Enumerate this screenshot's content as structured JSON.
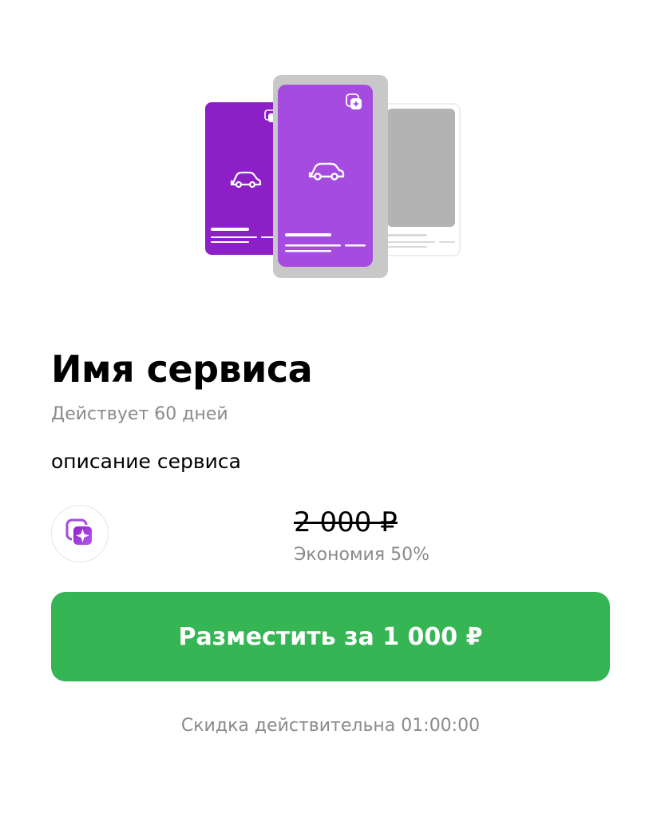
{
  "service": {
    "title": "Имя сервиса",
    "duration": "Действует 60 дней",
    "description": "описание сервиса"
  },
  "pricing": {
    "old_price": "2 000 ₽",
    "savings": "Экономия 50%"
  },
  "cta": {
    "label": "Разместить за 1 000 ₽"
  },
  "footer": {
    "timer_note": "Скидка действительна 01:00:00"
  },
  "colors": {
    "accent_green": "#36b555",
    "purple_dark": "#8d1fc7",
    "purple_light": "#a64be0",
    "muted_text": "#8a8a8a"
  },
  "icons": {
    "illustration_car": "car-icon",
    "service_badge": "service-stack-icon"
  }
}
